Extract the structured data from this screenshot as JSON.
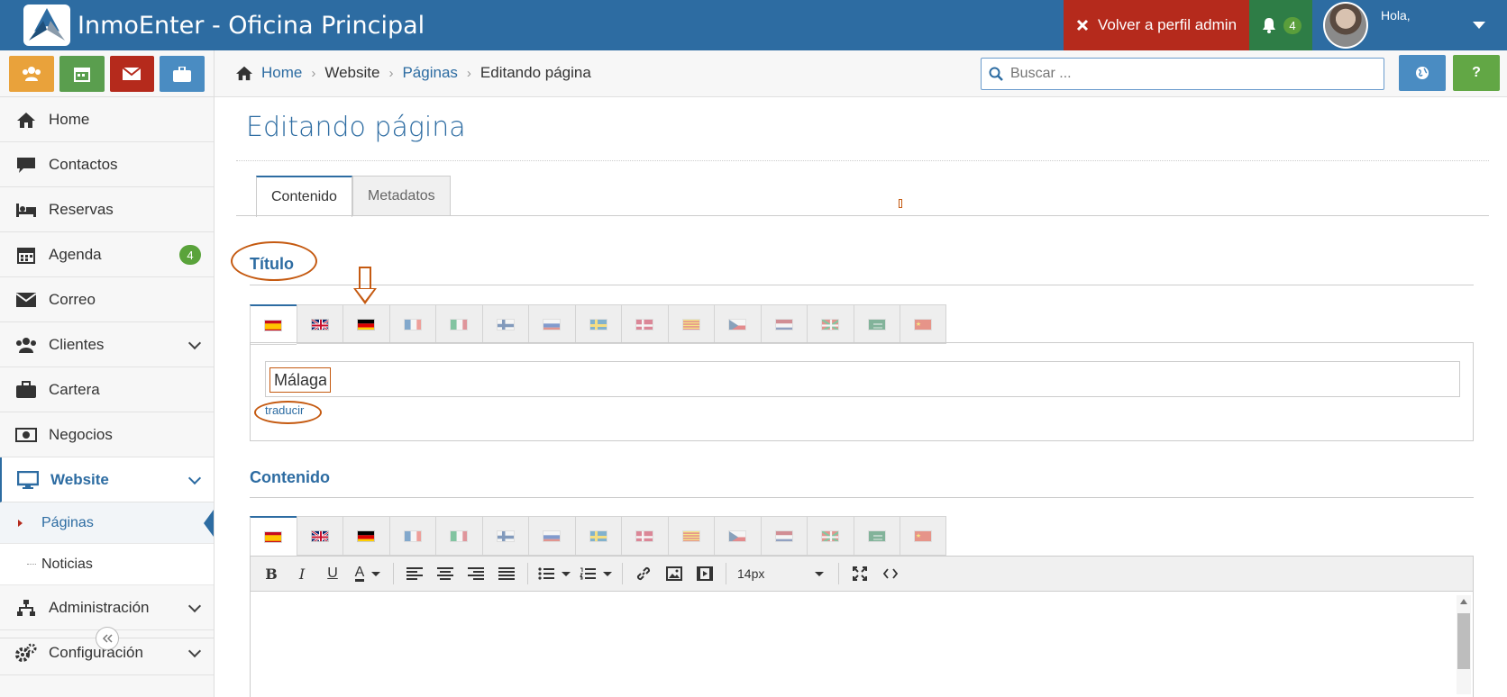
{
  "app": {
    "title": "InmoEnter - Oficina Principal"
  },
  "topbar": {
    "admin_label": "Volver a perfil admin",
    "notif_count": "4",
    "greeting": "Hola,",
    "colors": {
      "bar": "#2d6ca2",
      "admin": "#b52a1c",
      "notif": "#2e7d46"
    }
  },
  "shortcuts": [
    {
      "icon": "users-icon",
      "color": "#e9a23b"
    },
    {
      "icon": "calendar-icon",
      "color": "#5a9e4e"
    },
    {
      "icon": "envelope-icon",
      "color": "#b52a1c"
    },
    {
      "icon": "briefcase-icon",
      "color": "#4a8cc2"
    }
  ],
  "sidebar": {
    "items": [
      {
        "label": "Home",
        "icon": "home-icon"
      },
      {
        "label": "Contactos",
        "icon": "chat-icon"
      },
      {
        "label": "Reservas",
        "icon": "bed-icon"
      },
      {
        "label": "Agenda",
        "icon": "calendar-icon",
        "badge": "4"
      },
      {
        "label": "Correo",
        "icon": "envelope-icon"
      },
      {
        "label": "Clientes",
        "icon": "users-icon"
      },
      {
        "label": "Cartera",
        "icon": "briefcase-icon"
      },
      {
        "label": "Negocios",
        "icon": "money-icon"
      },
      {
        "label": "Website",
        "icon": "monitor-icon"
      },
      {
        "label": "Administración",
        "icon": "sitemap-icon"
      },
      {
        "label": "Configuración",
        "icon": "cogs-icon"
      }
    ],
    "website_sub": [
      {
        "label": "Páginas"
      },
      {
        "label": "Noticias"
      }
    ]
  },
  "breadcrumb": {
    "home": "Home",
    "website": "Website",
    "pages": "Páginas",
    "current": "Editando página"
  },
  "search": {
    "placeholder": "Buscar ..."
  },
  "help_label": "?",
  "page": {
    "title": "Editando página",
    "tabs": [
      {
        "label": "Contenido"
      },
      {
        "label": "Metadatos"
      }
    ],
    "title_section": {
      "label": "Título",
      "value": "Málaga",
      "translate": "traducir"
    },
    "content_section": {
      "label": "Contenido"
    },
    "languages": [
      "flag-es-icon",
      "flag-gb-icon",
      "flag-de-icon",
      "flag-fr-icon",
      "flag-it-icon",
      "flag-fi-icon",
      "flag-ru-icon",
      "flag-se-icon",
      "flag-dk-icon",
      "flag-ca-icon",
      "flag-cz-icon",
      "flag-nl-icon",
      "flag-eu-icon",
      "flag-sa-icon",
      "flag-cn-icon"
    ],
    "editor": {
      "font_size": "14px"
    }
  },
  "annotation_color": "#c55a11"
}
